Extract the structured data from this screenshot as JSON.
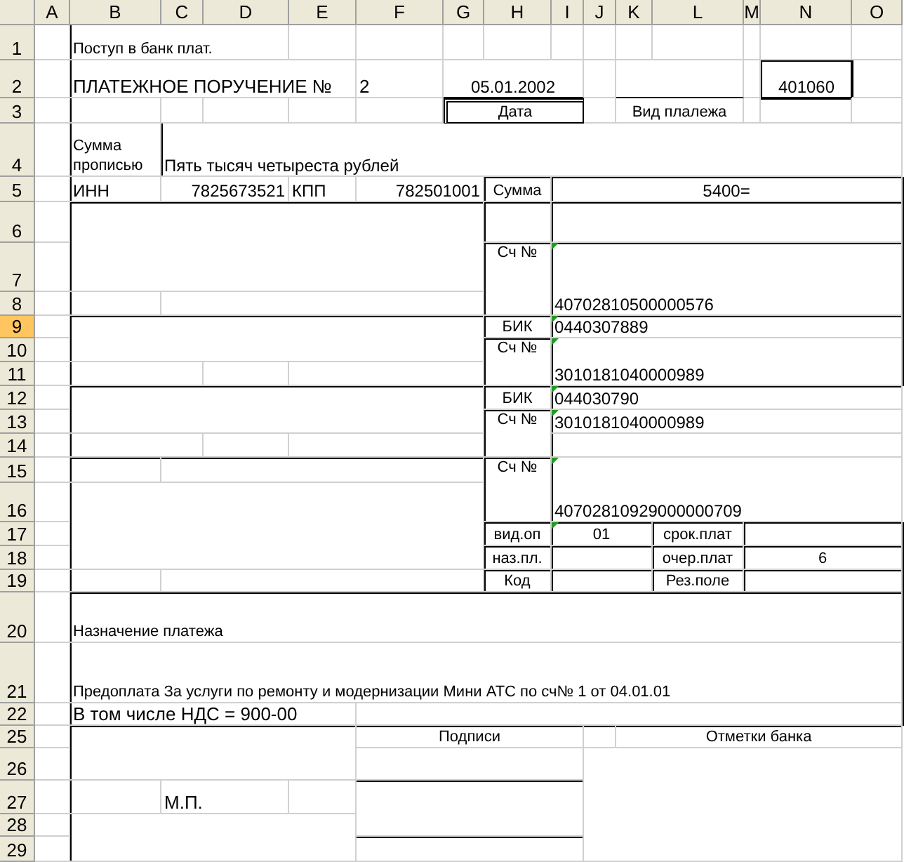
{
  "sheet": {
    "columns": [
      {
        "label": "A",
        "selected": false
      },
      {
        "label": "B",
        "selected": false
      },
      {
        "label": "C",
        "selected": false
      },
      {
        "label": "D",
        "selected": false
      },
      {
        "label": "E",
        "selected": false
      },
      {
        "label": "F",
        "selected": false
      },
      {
        "label": "G",
        "selected": false
      },
      {
        "label": "H",
        "selected": false
      },
      {
        "label": "I",
        "selected": false
      },
      {
        "label": "J",
        "selected": false
      },
      {
        "label": "K",
        "selected": false
      },
      {
        "label": "L",
        "selected": false
      },
      {
        "label": "M",
        "selected": false
      },
      {
        "label": "N",
        "selected": false
      },
      {
        "label": "O",
        "selected": false
      }
    ],
    "rows": [
      {
        "label": "1",
        "selected": false
      },
      {
        "label": "2",
        "selected": false
      },
      {
        "label": "3",
        "selected": false
      },
      {
        "label": "4",
        "selected": false
      },
      {
        "label": "5",
        "selected": false
      },
      {
        "label": "6",
        "selected": false
      },
      {
        "label": "7",
        "selected": false
      },
      {
        "label": "8",
        "selected": false
      },
      {
        "label": "9",
        "selected": true
      },
      {
        "label": "10",
        "selected": false
      },
      {
        "label": "11",
        "selected": false
      },
      {
        "label": "12",
        "selected": false
      },
      {
        "label": "13",
        "selected": false
      },
      {
        "label": "14",
        "selected": false
      },
      {
        "label": "15",
        "selected": false
      },
      {
        "label": "16",
        "selected": false
      },
      {
        "label": "17",
        "selected": false
      },
      {
        "label": "18",
        "selected": false
      },
      {
        "label": "19",
        "selected": false
      },
      {
        "label": "20",
        "selected": false
      },
      {
        "label": "21",
        "selected": false
      },
      {
        "label": "22",
        "selected": false
      },
      {
        "label": "25",
        "selected": false
      },
      {
        "label": "26",
        "selected": false
      },
      {
        "label": "27",
        "selected": false
      },
      {
        "label": "28",
        "selected": false
      },
      {
        "label": "29",
        "selected": false
      }
    ],
    "cells": [
      {
        "text": "Поступ в банк плат.",
        "flagged": false
      },
      {
        "text": "ПЛАТЕЖНОЕ ПОРУЧЕНИЕ №",
        "flagged": false
      },
      {
        "text": "2",
        "flagged": false
      },
      {
        "text": "05.01.2002",
        "flagged": false
      },
      {
        "text": "401060",
        "flagged": false
      },
      {
        "text": "Дата",
        "flagged": false
      },
      {
        "text": "Вид плалежа",
        "flagged": false
      },
      {
        "text": "Сумма прописью",
        "flagged": false
      },
      {
        "text": "Пять тысяч четыреста рублей",
        "flagged": false
      },
      {
        "text": "ИНН",
        "flagged": false
      },
      {
        "text": "7825673521",
        "flagged": false
      },
      {
        "text": "КПП",
        "flagged": false
      },
      {
        "text": "782501001",
        "flagged": false
      },
      {
        "text": "Сумма",
        "flagged": false
      },
      {
        "text": "5400=",
        "flagged": false
      },
      {
        "text": "Сч №",
        "flagged": false
      },
      {
        "text": "40702810500000576",
        "flagged": true
      },
      {
        "text": "БИК",
        "flagged": false
      },
      {
        "text": "0440307889",
        "flagged": true
      },
      {
        "text": "Сч №",
        "flagged": false
      },
      {
        "text": "3010181040000989",
        "flagged": true
      },
      {
        "text": "БИК",
        "flagged": false
      },
      {
        "text": "044030790",
        "flagged": true
      },
      {
        "text": "Сч №",
        "flagged": false
      },
      {
        "text": "3010181040000989",
        "flagged": true
      },
      {
        "text": "Сч №",
        "flagged": false
      },
      {
        "text": "40702810929000000709",
        "flagged": true
      },
      {
        "text": "вид.оп",
        "flagged": false
      },
      {
        "text": "01",
        "flagged": true
      },
      {
        "text": "срок.плат",
        "flagged": false
      },
      {
        "text": "наз.пл.",
        "flagged": false
      },
      {
        "text": "очер.плат",
        "flagged": false
      },
      {
        "text": "6",
        "flagged": false
      },
      {
        "text": "Код",
        "flagged": false
      },
      {
        "text": "Рез.поле",
        "flagged": false
      },
      {
        "text": "Назначение платежа",
        "flagged": false
      },
      {
        "text": "Предоплата За услуги по ремонту и модернизации Мини АТС по сч№ 1 от 04.01.01",
        "flagged": false
      },
      {
        "text": "В том числе НДС = 900-00",
        "flagged": false
      },
      {
        "text": "Подписи",
        "flagged": false
      },
      {
        "text": "Отметки банка",
        "flagged": false
      },
      {
        "text": "М.П.",
        "flagged": false
      }
    ]
  }
}
